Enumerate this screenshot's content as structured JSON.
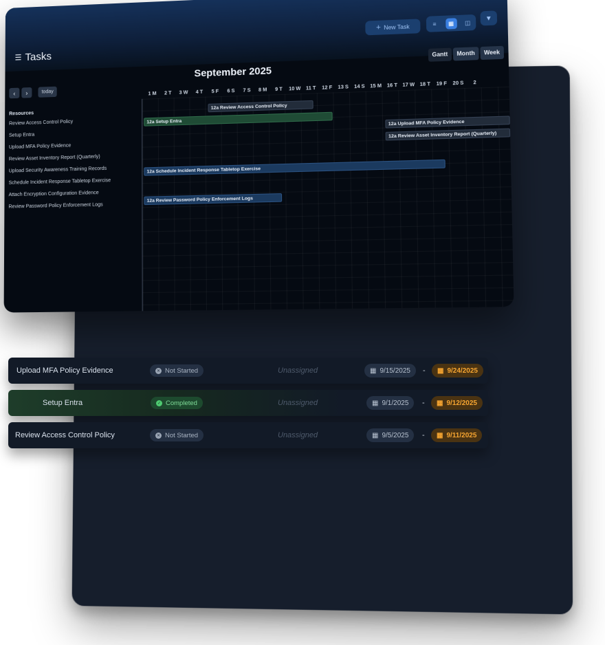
{
  "header": {
    "title": "Tasks",
    "new_task_label": "New Task",
    "views": [
      "Gantt",
      "Month",
      "Week"
    ],
    "active_view": "Gantt"
  },
  "nav": {
    "prev": "‹",
    "next": "›",
    "today": "today"
  },
  "calendar": {
    "month_title": "September 2025",
    "days": [
      "1 M",
      "2 T",
      "3 W",
      "4 T",
      "5 F",
      "6 S",
      "7 S",
      "8 M",
      "9 T",
      "10 W",
      "11 T",
      "12 F",
      "13 S",
      "14 S",
      "15 M",
      "16 T",
      "17 W",
      "18 T",
      "19 F",
      "20 S",
      "2"
    ]
  },
  "resources": {
    "heading": "Resources",
    "items": [
      "Review Access Control Policy",
      "Setup Entra",
      "Upload MFA Policy Evidence",
      "Review Asset Inventory Report (Quarterly)",
      "Upload Security Awareness Training Records",
      "Schedule Incident Response Tabletop Exercise",
      "Attach Encryption Configuration Evidence",
      "Review Password Policy Enforcement Logs"
    ]
  },
  "bars": [
    {
      "label": "12a Review Access Control Policy",
      "color": "gray"
    },
    {
      "label": "12a Setup Entra",
      "color": "green"
    },
    {
      "label": "12a Upload MFA Policy Evidence",
      "color": "gray"
    },
    {
      "label": "12a Review Asset Inventory Report (Quarterly)",
      "color": "gray"
    },
    {
      "label": "12a Schedule Incident Response Tabletop Exercise",
      "color": "blue"
    },
    {
      "label": "12a Review Password Policy Enforcement Logs",
      "color": "blue"
    }
  ],
  "task_list": [
    {
      "name": "Upload MFA Policy Evidence",
      "status": "Not Started",
      "assignee": "Unassigned",
      "start": "9/15/2025",
      "due": "9/24/2025"
    },
    {
      "name": "Setup Entra",
      "status": "Completed",
      "assignee": "Unassigned",
      "start": "9/1/2025",
      "due": "9/12/2025"
    },
    {
      "name": "Review Access Control Policy",
      "status": "Not Started",
      "assignee": "Unassigned",
      "start": "9/5/2025",
      "due": "9/11/2025"
    }
  ],
  "separator": "-",
  "colors": {
    "accent": "#3a7fe0",
    "completed": "#4ecb71",
    "due": "#f6a531"
  }
}
